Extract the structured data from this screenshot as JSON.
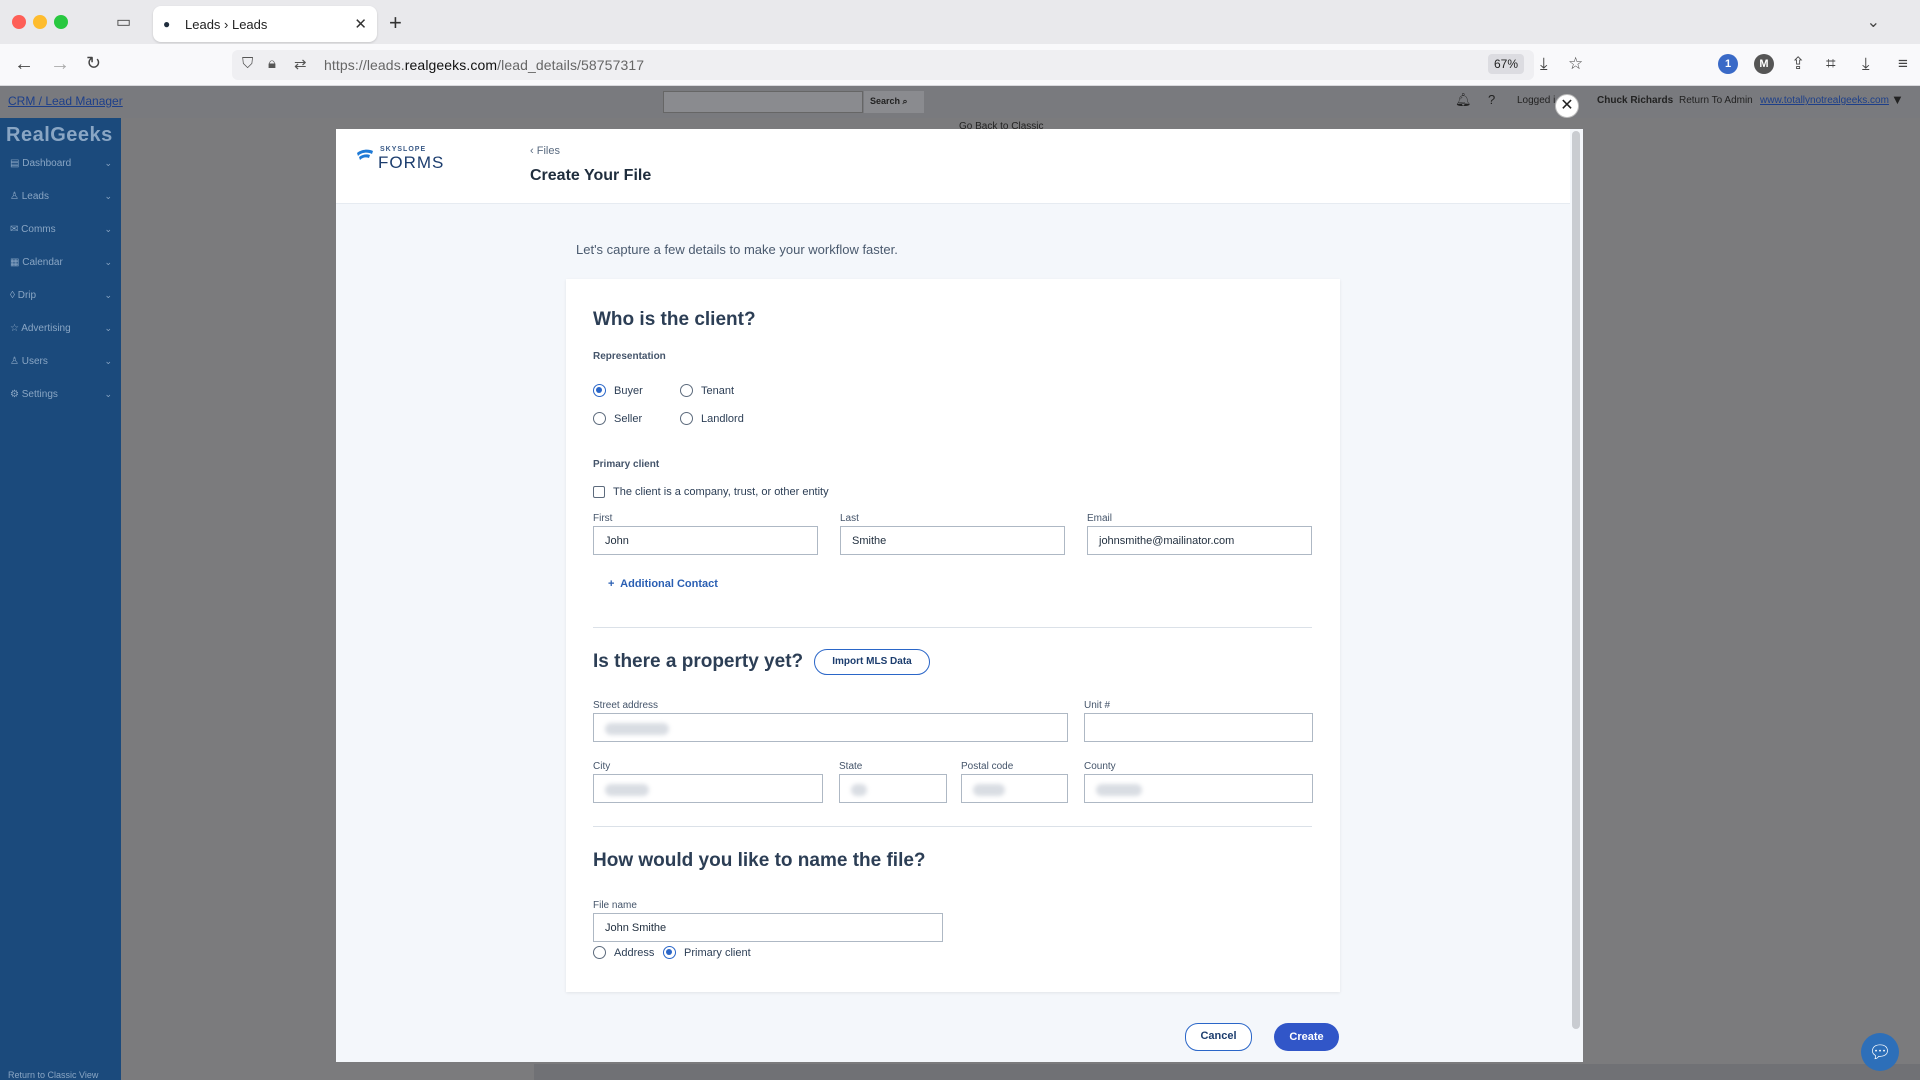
{
  "browser": {
    "tab_title": "Leads › Leads",
    "url_prefix": "https://leads.",
    "url_domain": "realgeeks.com",
    "url_path": "/lead_details/58757317",
    "zoom": "67%"
  },
  "site": {
    "crm_link": "CRM / Lead Manager",
    "search_button": "Search",
    "logged_in": "Logged i",
    "user_name": "Chuck Richards",
    "return_admin": "Return To Admin",
    "site_link": "www.totallynotrealgeeks.com",
    "go_back_classic": "Go Back to Classic",
    "logo": "RealGeeks",
    "sidebar": [
      "Dashboard",
      "Leads",
      "Comms",
      "Calendar",
      "Drip",
      "Advertising",
      "Users",
      "Settings"
    ],
    "footer": "Return to Classic View"
  },
  "modal": {
    "brand_small": "SKYSLOPE",
    "brand_main": "FORMS",
    "breadcrumb": "Files",
    "title": "Create Your File",
    "intro": "Let's capture a few details to make your workflow faster.",
    "client_section": {
      "heading": "Who is the client?",
      "representation_label": "Representation",
      "options": [
        {
          "label": "Buyer",
          "selected": true
        },
        {
          "label": "Tenant",
          "selected": false
        },
        {
          "label": "Seller",
          "selected": false
        },
        {
          "label": "Landlord",
          "selected": false
        }
      ],
      "primary_label": "Primary client",
      "entity_checkbox": "The client is a company, trust, or other entity",
      "first_label": "First",
      "first_value": "John",
      "last_label": "Last",
      "last_value": "Smithe",
      "email_label": "Email",
      "email_value": "johnsmithe@mailinator.com",
      "additional_contact": "Additional Contact"
    },
    "property_section": {
      "heading": "Is there a property yet?",
      "import_button": "Import MLS Data",
      "street_label": "Street address",
      "unit_label": "Unit #",
      "city_label": "City",
      "state_label": "State",
      "postal_label": "Postal code",
      "county_label": "County"
    },
    "file_section": {
      "heading": "How would you like to name the file?",
      "file_name_label": "File name",
      "file_name_value": "John Smithe",
      "options": [
        {
          "label": "Address",
          "selected": false
        },
        {
          "label": "Primary client",
          "selected": true
        }
      ]
    },
    "cancel": "Cancel",
    "create": "Create"
  },
  "colors": {
    "accent": "#3156c8",
    "sidebar": "#1b4a7c"
  }
}
